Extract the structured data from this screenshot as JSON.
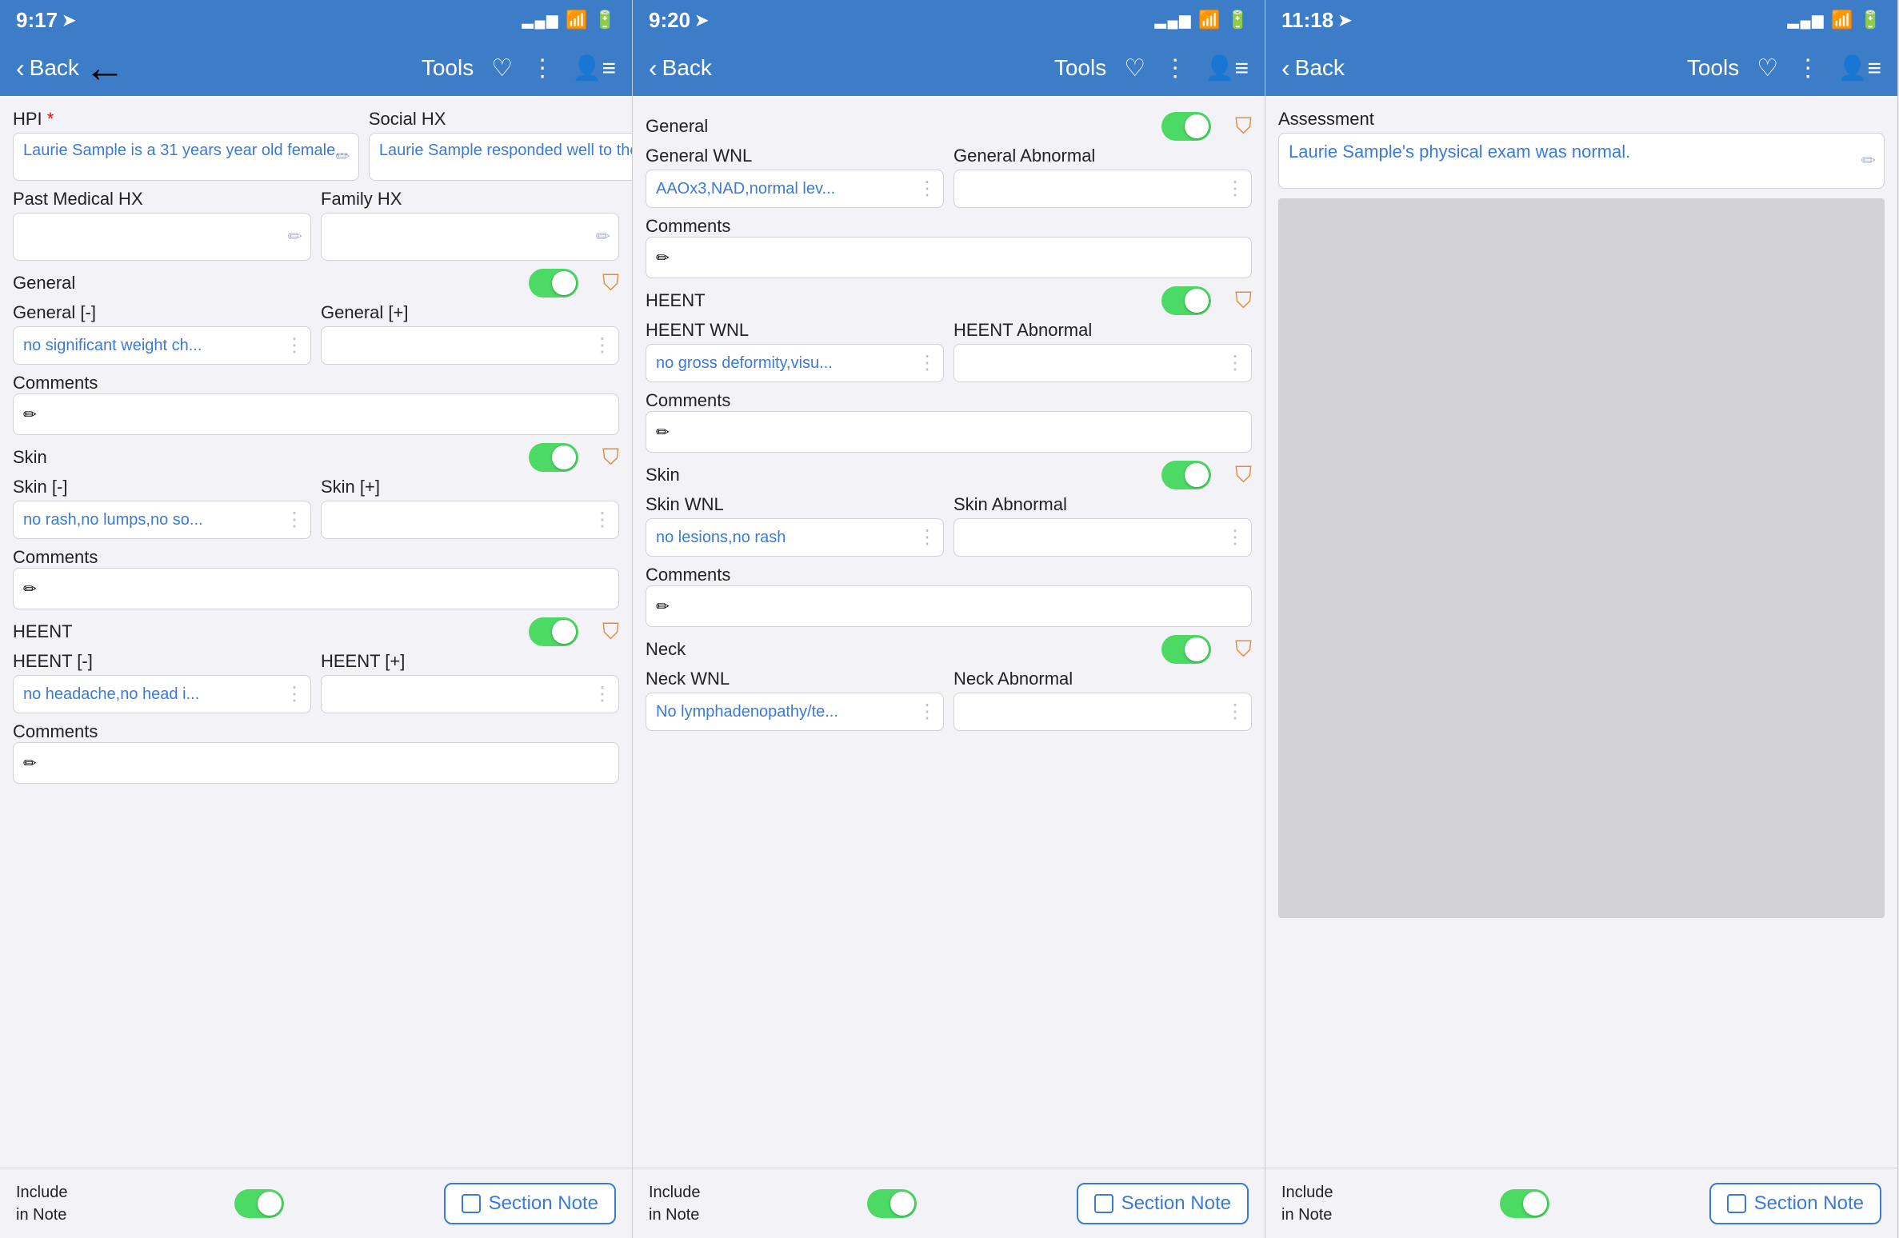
{
  "panels": [
    {
      "id": "panel1",
      "status_time": "9:17",
      "nav_back_label": "Back",
      "nav_title_label": "Tools",
      "show_back_arrow_big": true,
      "fields": [
        {
          "type": "two_col",
          "left": {
            "label": "HPI",
            "required": true,
            "value": "Laurie Sample is a 31 years year old female...",
            "has_edit": true
          },
          "right": {
            "label": "Social HX",
            "value": "Laurie Sample responded well to the...",
            "has_edit": true
          }
        },
        {
          "type": "two_col",
          "left": {
            "label": "Past Medical HX",
            "value": "",
            "has_edit": true
          },
          "right": {
            "label": "Family HX",
            "value": "",
            "has_edit": true
          }
        },
        {
          "type": "toggle_section",
          "label": "General",
          "toggle_on": true
        },
        {
          "type": "two_col_neg_pos",
          "left_label": "General [-]",
          "left_value": "no significant weight ch...",
          "right_label": "General [+]",
          "right_value": ""
        },
        {
          "type": "comments",
          "label": "Comments",
          "value": "",
          "has_edit": true
        },
        {
          "type": "toggle_section",
          "label": "Skin",
          "toggle_on": true
        },
        {
          "type": "two_col_neg_pos",
          "left_label": "Skin [-]",
          "left_value": "no rash,no lumps,no so...",
          "right_label": "Skin [+]",
          "right_value": ""
        },
        {
          "type": "comments",
          "label": "Comments",
          "value": "",
          "has_edit": true
        },
        {
          "type": "toggle_section",
          "label": "HEENT",
          "toggle_on": true
        },
        {
          "type": "two_col_neg_pos",
          "left_label": "HEENT [-]",
          "left_value": "no headache,no head i...",
          "right_label": "HEENT [+]",
          "right_value": ""
        },
        {
          "type": "comments",
          "label": "Comments",
          "value": "",
          "has_edit": true
        }
      ],
      "bottom": {
        "include_label_line1": "Include",
        "include_label_line2": "in Note",
        "toggle_on": true,
        "section_note_label": "Section Note"
      }
    },
    {
      "id": "panel2",
      "status_time": "9:20",
      "nav_back_label": "Back",
      "nav_title_label": "Tools",
      "show_back_arrow_big": false,
      "fields": [
        {
          "type": "toggle_section",
          "label": "General",
          "toggle_on": true
        },
        {
          "type": "wnl_row",
          "wnl_label": "General WNL",
          "wnl_value": "AAOx3,NAD,normal lev...",
          "abn_label": "General Abnormal",
          "abn_value": ""
        },
        {
          "type": "comments",
          "label": "Comments",
          "value": "",
          "has_edit": true
        },
        {
          "type": "toggle_section",
          "label": "HEENT",
          "toggle_on": true
        },
        {
          "type": "wnl_row",
          "wnl_label": "HEENT WNL",
          "wnl_value": "no gross deformity,visu...",
          "abn_label": "HEENT Abnormal",
          "abn_value": ""
        },
        {
          "type": "comments",
          "label": "Comments",
          "value": "",
          "has_edit": true
        },
        {
          "type": "toggle_section",
          "label": "Skin",
          "toggle_on": true
        },
        {
          "type": "wnl_row",
          "wnl_label": "Skin WNL",
          "wnl_value": "no lesions,no rash",
          "abn_label": "Skin Abnormal",
          "abn_value": ""
        },
        {
          "type": "comments",
          "label": "Comments",
          "value": "",
          "has_edit": true
        },
        {
          "type": "toggle_section",
          "label": "Neck",
          "toggle_on": true
        },
        {
          "type": "wnl_row",
          "wnl_label": "Neck WNL",
          "wnl_value": "No lymphadenopathy/te...",
          "abn_label": "Neck Abnormal",
          "abn_value": ""
        }
      ],
      "bottom": {
        "include_label_line1": "Include",
        "include_label_line2": "in Note",
        "toggle_on": true,
        "section_note_label": "Section Note"
      }
    },
    {
      "id": "panel3",
      "status_time": "11:18",
      "nav_back_label": "Back",
      "nav_title_label": "Tools",
      "show_back_arrow_big": false,
      "fields": [
        {
          "type": "assessment_field",
          "label": "Assessment",
          "value": "Laurie Sample's physical exam was normal.",
          "has_edit": true
        },
        {
          "type": "gray_area"
        }
      ],
      "bottom": {
        "include_label_line1": "Include",
        "include_label_line2": "in Note",
        "toggle_on": true,
        "section_note_label": "Section Note"
      }
    }
  ],
  "icons": {
    "back_arrow": "‹",
    "tools_heart": "♡",
    "more_vert": "⋮",
    "person_list": "👤",
    "edit_pencil": "✏",
    "org_chart": "⛉",
    "signal": "▂▄▆",
    "wifi": "wifi",
    "battery": "▮"
  }
}
